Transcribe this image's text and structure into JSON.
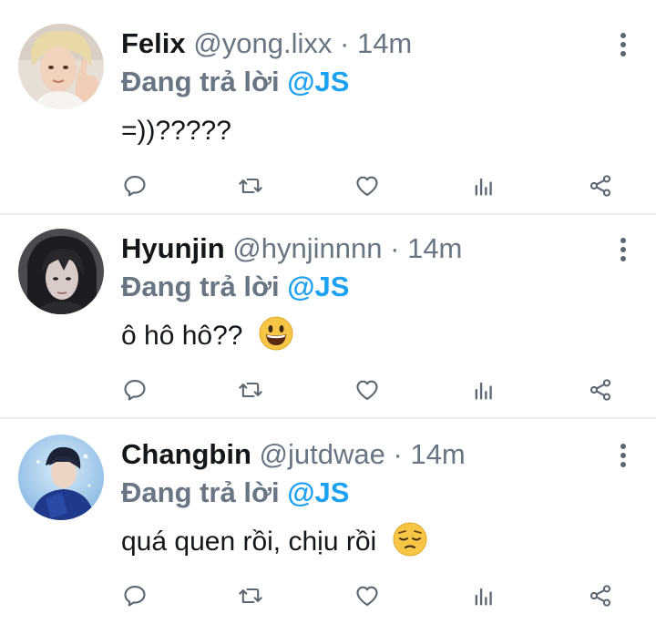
{
  "tweets": [
    {
      "name": "Felix",
      "handle": "@yong.lixx",
      "separator": "·",
      "time": "14m",
      "replying_prefix": "Đang trả lời ",
      "replying_to": "@JS",
      "text": "=))?????",
      "emoji": null
    },
    {
      "name": "Hyunjin",
      "handle": "@hynjinnnn",
      "separator": "·",
      "time": "14m",
      "replying_prefix": "Đang trả lời ",
      "replying_to": "@JS",
      "text": "ô hô hô??",
      "emoji": "grinning-face-with-big-eyes"
    },
    {
      "name": "Changbin",
      "handle": "@jutdwae",
      "separator": "·",
      "time": "14m",
      "replying_prefix": "Đang trả lời ",
      "replying_to": "@JS",
      "text": "quá quen rồi, chịu rồi",
      "emoji": "pensive-face"
    }
  ],
  "actions": [
    "reply-icon",
    "retweet-icon",
    "like-icon",
    "stats-icon",
    "share-icon"
  ],
  "colors": {
    "mention": "#1da1f2",
    "secondary": "#687684",
    "primary": "#14171a",
    "separator": "#e6ecf0"
  }
}
